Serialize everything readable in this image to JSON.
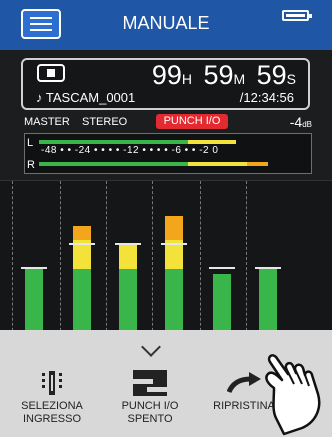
{
  "header": {
    "title": "MANUALE",
    "menu_icon": "menu-icon",
    "battery_icon": "battery-icon"
  },
  "transport": {
    "state_icon": "stop-icon",
    "hours": "99",
    "hours_unit": "H",
    "minutes": "59",
    "minutes_unit": "M",
    "seconds": "59",
    "seconds_unit": "S",
    "filename": "♪ TASCAM_0001",
    "total": "/12:34:56"
  },
  "meter": {
    "source": "MASTER",
    "mode": "STEREO",
    "punch_label": "PUNCH I/O",
    "gain": "-4",
    "gain_unit": "dB",
    "left_label": "L",
    "right_label": "R",
    "scale": "-48  •  •  -24  •  •  •  •  -12  •  •  •  •  -6  •  •  -2 0",
    "left_level_fraction": 0.73,
    "right_level_fraction": 0.85
  },
  "channels": {
    "levels": [
      0.45,
      0.72,
      0.6,
      0.78,
      0.42,
      0.45
    ],
    "markers": [
      0.45,
      0.6,
      0.6,
      0.6,
      0.45,
      0.45
    ]
  },
  "actions": {
    "input": {
      "line1": "SELEZIONA",
      "line2": "INGRESSO",
      "icon": "input-select-icon"
    },
    "punch": {
      "line1": "PUNCH I/O",
      "line2": "SPENTO",
      "icon": "punch-icon"
    },
    "restore": {
      "line1": "RIPRISTINA",
      "icon": "restore-arrow-icon"
    }
  },
  "colors": {
    "header": "#1f56a6",
    "accent": "#e32a30",
    "meter_green": "#3ab54a",
    "meter_yellow": "#f3e23a",
    "meter_orange": "#f3a51c"
  }
}
